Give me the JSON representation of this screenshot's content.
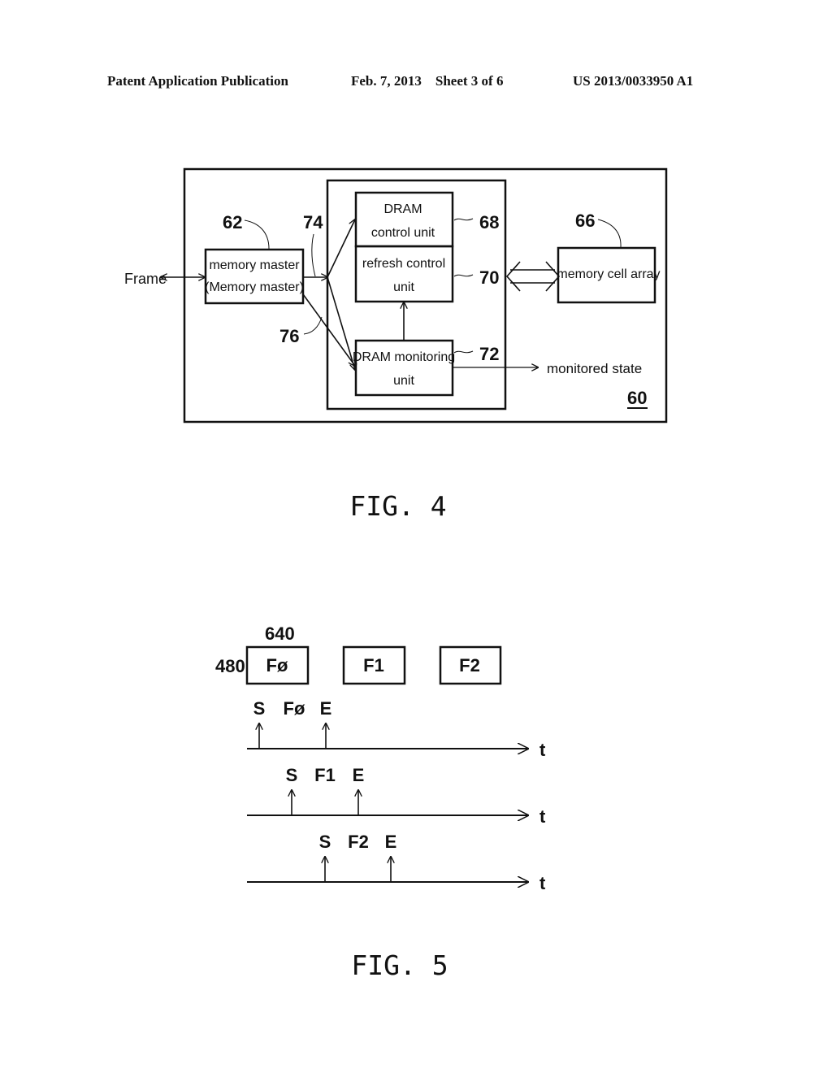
{
  "header": {
    "left": "Patent Application Publication",
    "middle": "Feb. 7, 2013    Sheet 3 of 6",
    "right": "US 2013/0033950 A1"
  },
  "fig4": {
    "caption": "FIG. 4",
    "system_ref": "60",
    "external_label": "Frame",
    "memory_master": {
      "ref": "62",
      "line1": "memory master",
      "line2": "(Memory master)"
    },
    "path_refs": {
      "upper": "74",
      "lower": "76"
    },
    "dram_control_unit": {
      "ref": "68",
      "line1": "DRAM",
      "line2": "control unit"
    },
    "refresh_control_unit": {
      "ref": "70",
      "line1": "refresh control",
      "line2": "unit"
    },
    "dram_monitoring_unit": {
      "ref": "72",
      "line1": "DRAM monitoring",
      "line2": "unit"
    },
    "memory_cell_array": {
      "ref": "66",
      "label": "memory cell array"
    },
    "output_label": "monitored state"
  },
  "fig5": {
    "caption": "FIG. 5",
    "frame_width_label": "640",
    "frame_height_label": "480",
    "frames": [
      "Fø",
      "F1",
      "F2"
    ],
    "timelines": [
      {
        "start": "S",
        "frame": "Fø",
        "end": "E",
        "axis": "t"
      },
      {
        "start": "S",
        "frame": "F1",
        "end": "E",
        "axis": "t"
      },
      {
        "start": "S",
        "frame": "F2",
        "end": "E",
        "axis": "t"
      }
    ]
  }
}
